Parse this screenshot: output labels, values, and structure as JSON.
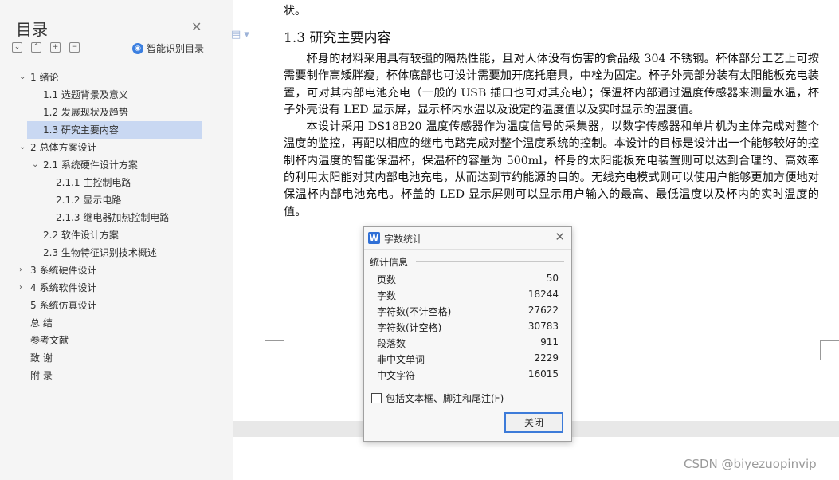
{
  "sidebar": {
    "title": "目录",
    "close_glyph": "✕",
    "tools": [
      "⌄",
      "⌃",
      "+",
      "−"
    ],
    "smart_toc_label": "智能识别目录",
    "items": [
      {
        "label": "1  绪论",
        "arrow": "⌄"
      },
      {
        "label": "1.1  选题背景及意义",
        "arrow": ""
      },
      {
        "label": "1.2  发展现状及趋势",
        "arrow": ""
      },
      {
        "label": "1.3  研究主要内容",
        "arrow": ""
      },
      {
        "label": "2  总体方案设计",
        "arrow": "⌄"
      },
      {
        "label": "2.1  系统硬件设计方案",
        "arrow": "⌄"
      },
      {
        "label": "2.1.1  主控制电路",
        "arrow": ""
      },
      {
        "label": "2.1.2  显示电路",
        "arrow": ""
      },
      {
        "label": "2.1.3  继电器加热控制电路",
        "arrow": ""
      },
      {
        "label": "2.2  软件设计方案",
        "arrow": ""
      },
      {
        "label": "2.3  生物特征识别技术概述",
        "arrow": ""
      },
      {
        "label": "3  系统硬件设计",
        "arrow": "›"
      },
      {
        "label": "4  系统软件设计",
        "arrow": "›"
      },
      {
        "label": "5  系统仿真设计",
        "arrow": ""
      },
      {
        "label": "总    结",
        "arrow": ""
      },
      {
        "label": "参考文献",
        "arrow": ""
      },
      {
        "label": "致    谢",
        "arrow": ""
      },
      {
        "label": "附    录",
        "arrow": ""
      }
    ]
  },
  "document": {
    "top_fragment": "状。",
    "heading": "1.3  研究主要内容",
    "paragraphs": [
      "杯身的材料采用具有较强的隔热性能，且对人体没有伤害的食品级 304 不锈钢。杯体部分工艺上可按需要制作高矮胖瘦，杯体底部也可设计需要加开底托磨具，中栓为固定。杯子外壳部分装有太阳能板充电装置，可对其内部电池充电（一般的 USB 插口也可对其充电）；保温杯内部通过温度传感器来测量水温，杯子外壳设有 LED 显示屏，显示杯内水温以及设定的温度值以及实时显示的温度值。",
      "本设计采用 DS18B20 温度传感器作为温度信号的采集器，以数字传感器和单片机为主体完成对整个温度的监控，再配以相应的继电电路完成对整个温度系统的控制。本设计的目标是设计出一个能够较好的控制杯内温度的智能保温杯，保温杯的容量为 500ml，杯身的太阳能板充电装置则可以达到合理的、高效率的利用太阳能对其内部电池充电，从而达到节约能源的目的。无线充电模式则可以使用户能够更加方便地对保温杯内部电池充电。杯盖的 LED 显示屏则可以显示用户输入的最高、最低温度以及杯内的实时温度的值。"
    ]
  },
  "dialog": {
    "title": "字数统计",
    "logo": "W",
    "close_glyph": "✕",
    "section_label": "统计信息",
    "stats": [
      {
        "label": "页数",
        "value": "50"
      },
      {
        "label": "字数",
        "value": "18244"
      },
      {
        "label": "字符数(不计空格)",
        "value": "27622"
      },
      {
        "label": "字符数(计空格)",
        "value": "30783"
      },
      {
        "label": "段落数",
        "value": "911"
      },
      {
        "label": "非中文单词",
        "value": "2229"
      },
      {
        "label": "中文字符",
        "value": "16015"
      }
    ],
    "checkbox_label": "包括文本框、脚注和尾注(F)",
    "checkbox_checked": false,
    "close_button_label": "关闭"
  },
  "watermark": "CSDN @biyezuopinvip"
}
